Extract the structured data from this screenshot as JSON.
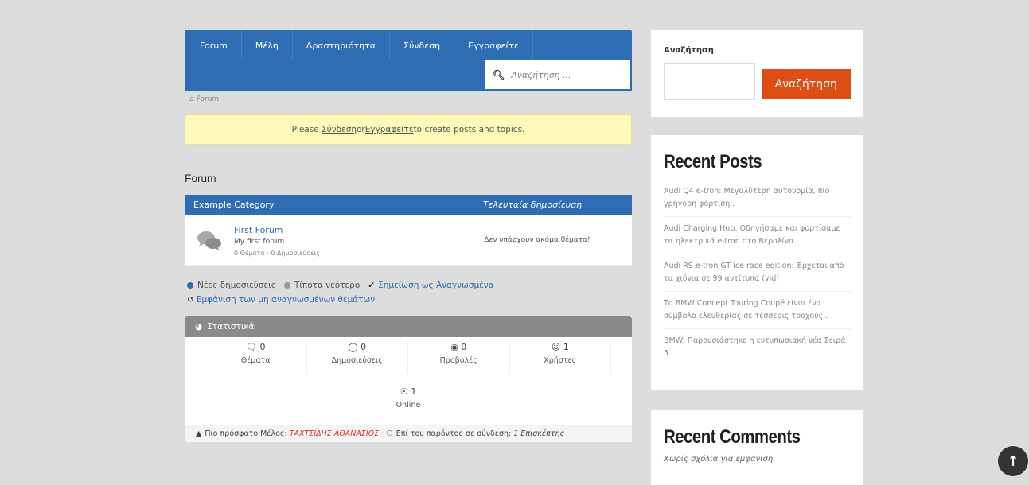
{
  "nav": {
    "items": [
      "Forum",
      "Μέλη",
      "Δραστηριότητα",
      "Σύνδεση",
      "Εγγραφείτε"
    ],
    "search_placeholder": "Αναζήτηση ..."
  },
  "breadcrumb": "Forum",
  "notice": {
    "prefix": "Please ",
    "login": "Σύνδεση",
    "mid": " or ",
    "register": "Εγγραφείτε",
    "suffix": " to create posts and topics."
  },
  "section_title": "Forum",
  "category": {
    "name": "Example Category",
    "last_post_header": "Τελευταία δημοσίευση",
    "forum": {
      "name": "First Forum",
      "description": "My first forum.",
      "meta": "0 Θέματα · 0 Δημοσιεύσεις",
      "last_post": "Δεν υπάρχουν ακόμα θέματα!"
    }
  },
  "legend": {
    "new_posts": "Νέες δημοσιεύσεις",
    "nothing_new": "Τίποτα νεότερο",
    "mark_read": "Σημείωση ως Αναγνωσμένα",
    "show_unread": "Εμφάνιση των μη αναγνωσμένων θεμάτων"
  },
  "stats": {
    "title": "Στατιστικά",
    "items": [
      {
        "icon": "topics-icon",
        "value": "0",
        "label": "Θέματα"
      },
      {
        "icon": "posts-icon",
        "value": "0",
        "label": "Δημοσιεύσεις"
      },
      {
        "icon": "views-icon",
        "value": "0",
        "label": "Προβολές"
      },
      {
        "icon": "users-icon",
        "value": "1",
        "label": "Χρήστες"
      }
    ],
    "online": {
      "value": "1",
      "label": "Online"
    },
    "footer": {
      "latest_member_label": "Πιο πρόσφατο Μέλος:",
      "latest_member": "ΤΑΧΤΣΙΔΗΣ ΑΘΑΝΑΣΙΟΣ",
      "online_label": "Επί του παρόντος σε σύνδεση:",
      "online_value": "1 Επισκέπτης"
    }
  },
  "sidebar": {
    "search": {
      "title": "Αναζήτηση",
      "button": "Αναζήτηση"
    },
    "recent_posts": {
      "title": "Recent Posts",
      "items": [
        "Audi Q4 e-tron: Μεγαλύτερη αυτονομία, πιο γρήγορη φόρτιση..",
        "Audi Charging Hub: Οδηγήσαμε και φορτίσαμε τα ηλεκτρικά e-tron στο Βερολίνο",
        "Audi RS e-tron GT ice race edition: Έρχεται από τα χιόνια σε 99 αντίτυπα (vid)",
        "Το BMW Concept Touring Coupé είναι ένα σύμβολο ελευθερίας σε τέσσερις τροχούς..",
        "BMW: Παρουσιάστηκε η εντυπωσιακή νέα Σειρά 5"
      ]
    },
    "recent_comments": {
      "title": "Recent Comments",
      "empty": "Χωρίς σχόλια για εμφάνιση."
    }
  },
  "colors": {
    "primary": "#2e6db4",
    "accent": "#dd4e15",
    "notice_bg": "#fdf9b8"
  }
}
